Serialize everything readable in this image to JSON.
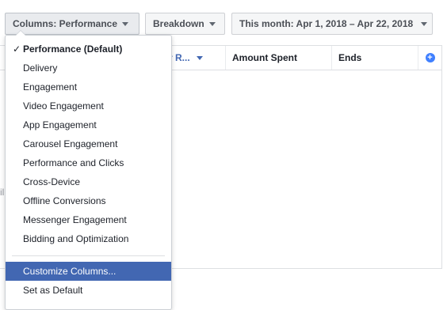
{
  "toolbar": {
    "columns_label": "Columns: Performance",
    "breakdown_label": "Breakdown",
    "date_label": "This month: Apr 1, 2018 – Apr 22, 2018"
  },
  "table": {
    "headers": {
      "result": "r R...",
      "amount_spent": "Amount Spent",
      "ends": "Ends"
    },
    "row_edge_text": "il"
  },
  "columns_menu": {
    "check_mark": "✓",
    "items": [
      "Performance (Default)",
      "Delivery",
      "Engagement",
      "Video Engagement",
      "App Engagement",
      "Carousel Engagement",
      "Performance and Clicks",
      "Cross-Device",
      "Offline Conversions",
      "Messenger Engagement",
      "Bidding and Optimization"
    ],
    "selected_index": 0,
    "actions": [
      "Customize Columns...",
      "Set as Default"
    ],
    "active_action_index": 0
  },
  "colors": {
    "highlight": "#4267b2",
    "link_blue": "#4080ff"
  }
}
